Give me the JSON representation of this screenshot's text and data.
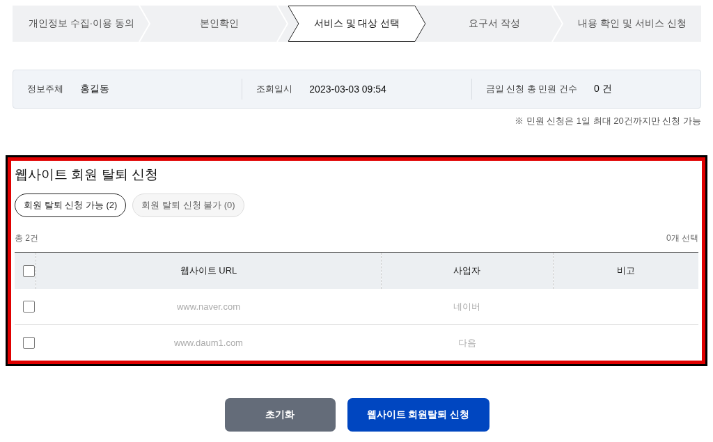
{
  "steps": [
    {
      "label": "개인정보 수집·이용 동의",
      "selected": false
    },
    {
      "label": "본인확인",
      "selected": false
    },
    {
      "label": "서비스 및 대상 선택",
      "selected": true
    },
    {
      "label": "요구서 작성",
      "selected": false
    },
    {
      "label": "내용 확인 및 서비스 신청",
      "selected": false
    }
  ],
  "info": [
    {
      "label": "정보주체",
      "value": "홍길동"
    },
    {
      "label": "조회일시",
      "value": "2023-03-03 09:54"
    },
    {
      "label": "금일 신청 총 민원 건수",
      "value": "0 건"
    }
  ],
  "notice": "※ 민원 신청은 1일 최대 20건까지만 신청 가능",
  "section": {
    "title": "웹사이트 회원 탈퇴 신청",
    "filters": [
      {
        "label": "회원 탈퇴 신청 가능 (2)",
        "selected": true
      },
      {
        "label": "회원 탈퇴 신청 불가 (0)",
        "selected": false
      }
    ],
    "total": "총 2건",
    "selected_count": "0개 선택",
    "table": {
      "select_all_checked": false,
      "columns": [
        "웹사이트 URL",
        "사업자",
        "비고"
      ],
      "rows": [
        {
          "checked": false,
          "cells": [
            "www.naver.com",
            "네이버",
            ""
          ]
        },
        {
          "checked": false,
          "cells": [
            "www.daum1.com",
            "다음",
            ""
          ]
        }
      ]
    }
  },
  "buttons": [
    {
      "kind": "secondary",
      "label": "초기화"
    },
    {
      "kind": "primary",
      "label": "웹사이트 회원탈퇴 신청"
    }
  ]
}
